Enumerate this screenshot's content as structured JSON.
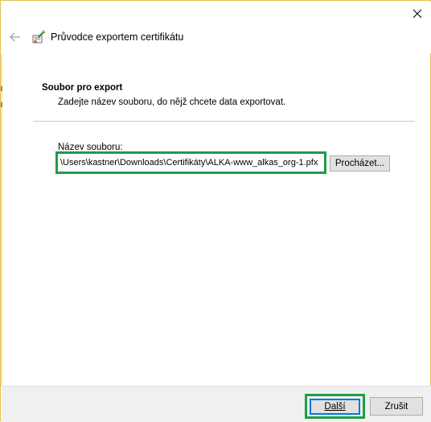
{
  "window": {
    "title": "Průvodce exportem certifikátu"
  },
  "section": {
    "title": "Soubor pro export",
    "description": "Zadejte název souboru, do nějž chcete data exportovat."
  },
  "file": {
    "label": "Název souboru:",
    "value": "\\Users\\kastner\\Downloads\\Certifikáty\\ALKA-www_alkas_org-1.pfx"
  },
  "buttons": {
    "browse_label": "Procházet...",
    "next_label": "Další",
    "cancel_label": "Zrušit"
  },
  "icons": {
    "back": "back-arrow-icon",
    "close": "close-icon",
    "wizard": "certificate-wizard-icon"
  },
  "colors": {
    "highlight": "#1c9e46",
    "focus": "#0078d7",
    "footer_bg": "#f0f0f0",
    "button_bg": "#e1e1e1"
  }
}
